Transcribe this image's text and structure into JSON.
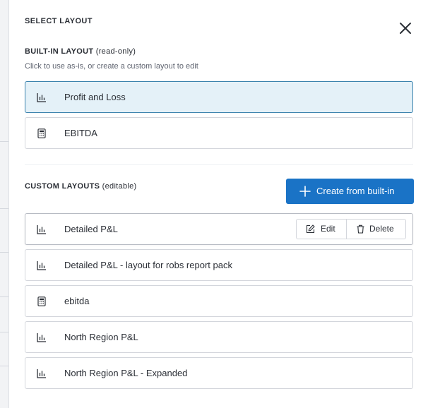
{
  "dialog": {
    "title": "SELECT LAYOUT",
    "close_icon": "close-icon"
  },
  "builtin": {
    "heading": "BUILT-IN LAYOUT",
    "heading_note": "(read-only)",
    "subtitle": "Click to use as-is, or create a custom layout to edit",
    "items": [
      {
        "label": "Profit and Loss",
        "icon": "bar-chart-icon",
        "selected": true
      },
      {
        "label": "EBITDA",
        "icon": "calculator-icon",
        "selected": false
      }
    ]
  },
  "custom": {
    "heading": "CUSTOM LAYOUTS",
    "heading_note": "(editable)",
    "create_button": "Create from built-in",
    "items": [
      {
        "label": "Detailed P&L",
        "icon": "bar-chart-icon",
        "hovered": true
      },
      {
        "label": "Detailed P&L - layout for robs report pack",
        "icon": "bar-chart-icon"
      },
      {
        "label": "ebitda",
        "icon": "calculator-icon"
      },
      {
        "label": "North Region P&L",
        "icon": "bar-chart-icon"
      },
      {
        "label": "North Region P&L - Expanded",
        "icon": "bar-chart-icon"
      }
    ],
    "row_actions": {
      "edit": "Edit",
      "delete": "Delete"
    }
  },
  "colors": {
    "accent": "#1a73c6",
    "selected_bg": "#e4f1f8",
    "selected_border": "#3a82ad"
  }
}
